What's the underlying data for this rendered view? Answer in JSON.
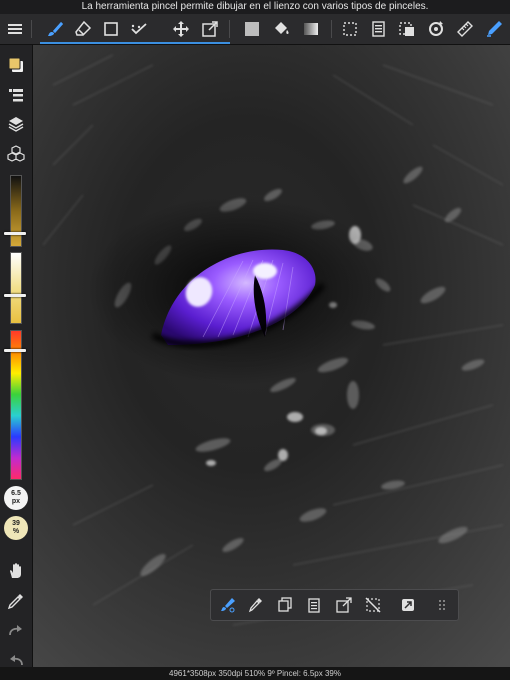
{
  "top_message": "La herramienta pincel permite dibujar en el lienzo con varios tipos de pinceles.",
  "status_bar": "4961*3508px 350dpi 510% 9º Pincel: 6.5px 39%",
  "brush": {
    "size_value": "6.5",
    "size_unit": "px",
    "opacity_value": "39",
    "opacity_unit": "%"
  },
  "colors": {
    "accent": "#3b8fe0",
    "current_color": "#e8c66a",
    "eye_purple": "#7a3cf0"
  },
  "toolbar_icons": [
    "menu-icon",
    "brush-icon",
    "eraser-icon",
    "select-rect-icon",
    "smudge-icon",
    "move-icon",
    "transform-icon",
    "fill-color-icon",
    "bucket-icon",
    "gradient-icon",
    "selection-icon",
    "layer-paste-icon",
    "select-tool-icon",
    "rotate-icon",
    "ruler-icon",
    "pen-icon"
  ],
  "sidebar_icons": [
    "color-swatch-icon",
    "layer-list-icon",
    "layers-icon",
    "materials-icon",
    "hand-icon",
    "eyedropper-icon",
    "redo-icon",
    "undo-icon"
  ],
  "floating_icons": [
    "brush-settings-icon",
    "eyedropper-icon",
    "copy-icon",
    "paste-icon",
    "transform-icon",
    "deselect-icon",
    "fullscreen-icon",
    "grip-icon"
  ]
}
